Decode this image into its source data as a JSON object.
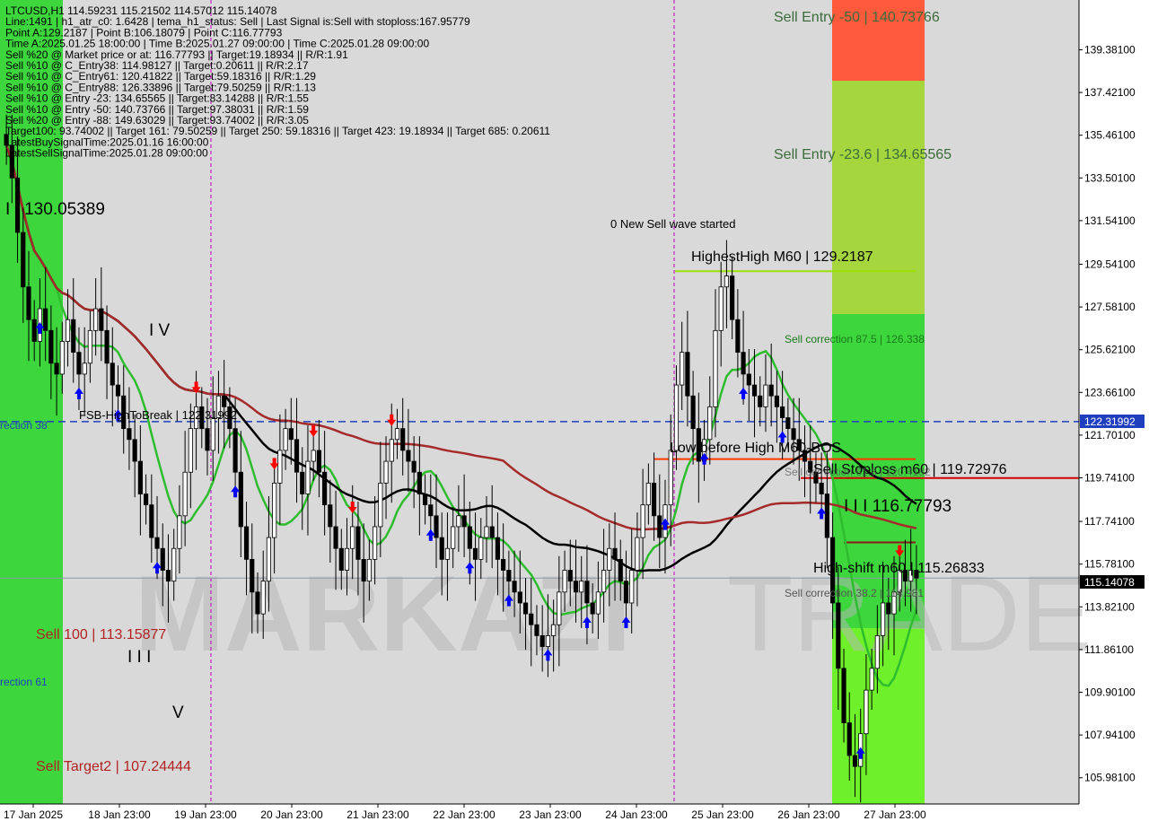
{
  "colors": {
    "background": "#dcdcdc",
    "panel_bg": "#ffffff",
    "up_candle": "#000000",
    "down_candle": "#000000",
    "wave_text": "#000000",
    "green_zone": "#3dd63d",
    "red_zone": "#ff5a3c",
    "fsb_line": "#1f3fbf",
    "price_label_bg": "#1f3fbf",
    "current_price_bg": "#000000",
    "sell_label": "#b22222",
    "ma_black": "#000000",
    "ma_brown": "#a52a2a",
    "ma_green": "#2ebd2e",
    "band_orange": "#ff6a00",
    "stoploss_red": "#d40000"
  },
  "info_panel": {
    "lines": [
      "LTCUSD,H1  114.59231 115.21502 114.57012 115.14078",
      "Line:1491 | h1_atr_c0: 1.6428 | tema_h1_status: Sell | Last Signal is:Sell with stoploss:167.95779",
      "Point A:129.2187 | Point B:106.18079 | Point C:116.77793",
      "Time A:2025.01.25 18:00:00 | Time B:2025.01.27 09:00:00 | Time C:2025.01.28 09:00:00",
      "Sell %20 @ Market price or at: 116.77793 || Target:19.18934 || R/R:1.91",
      "Sell %10 @ C_Entry38: 114.98127 || Target:0.20611 || R/R:2.17",
      "Sell %10 @ C_Entry61: 120.41822 || Target:59.18316 || R/R:1.29",
      "Sell %10 @ C_Entry88: 126.33896 || Target:79.50259 || R/R:1.13",
      "Sell %10 @ Entry -23: 134.65565 || Target:83.14288 || R/R:1.55",
      "Sell %10 @ Entry -50: 140.73766 || Target:97.38031 || R/R:1.59",
      "Sell %20 @ Entry -88: 149.63029 || Target:93.74002 || R/R:3.05",
      "Target100: 93.74002 || Target 161: 79.50259 || Target 250: 59.18316 || Target 423: 19.18934 || Target 685: 0.20611",
      "LatestBuySignalTime:2025.01.16 16:00:00",
      "LatestSellSignalTime:2025.01.28 09:00:00"
    ]
  },
  "levels": {
    "sell_entry_50": "Sell Entry -50 | 140.73766",
    "sell_entry_23": "Sell Entry -23.6 | 134.65565",
    "new_sell_wave": "0 New Sell wave started",
    "highest_high": "HighestHigh   M60 | 129.2187",
    "sell_correction_875": "Sell correction 87.5 | 126.338",
    "fsb_high": "FSB-HighToBreak | 122.31992",
    "correction_38": "rection 38",
    "low_before_high": "Low before High   M60-BOS",
    "sell_stoploss": "Sell Stoploss m60 | 119.72976",
    "sell_correction_mid": "Sell correction 61.8 | 120.4182",
    "wave_iii_price": "I I I 116.77793",
    "high_shift": "High-shift m60 | 115.26833",
    "sell_correction_low": "Sell correction 38.2 | 114.981",
    "sell_100": "Sell 100 | 113.15877",
    "correction_61": "rection 61",
    "sell_target2": "Sell Target2 | 107.24444",
    "wave_ii": "I I  130.05389",
    "wave_iv": "I V",
    "wave_iii_left": "I I I",
    "wave_v": "V"
  },
  "chart_data": {
    "type": "candlestick",
    "title": "LTCUSD,H1",
    "ylim": [
      104.9,
      141.5
    ],
    "y_ticks": [
      "139.38100",
      "137.42100",
      "135.46100",
      "133.50100",
      "131.54100",
      "129.54100",
      "127.58100",
      "125.62100",
      "123.66100",
      "121.70100",
      "119.74100",
      "117.74100",
      "115.78100",
      "113.82100",
      "111.86100",
      "109.90100",
      "107.94100",
      "105.98100"
    ],
    "x_ticks": [
      "17 Jan 2025",
      "18 Jan 23:00",
      "19 Jan 23:00",
      "20 Jan 23:00",
      "21 Jan 23:00",
      "22 Jan 23:00",
      "23 Jan 23:00",
      "24 Jan 23:00",
      "25 Jan 23:00",
      "26 Jan 23:00",
      "27 Jan 23:00"
    ],
    "price_labels": {
      "fsb": "122.31992",
      "current": "115.14078"
    },
    "key_prices": {
      "fsb": 122.31992,
      "current": 115.14078,
      "highest_high": 129.2187,
      "low_before_high": 120.6,
      "stoploss": 119.72976,
      "wave_iii": 116.77793,
      "high_shift": 115.26833
    },
    "close": [
      135.0,
      133.5,
      131.0,
      128.5,
      127.0,
      126.0,
      127.5,
      126.5,
      125.0,
      124.5,
      126.0,
      127.0,
      125.5,
      124.5,
      125.0,
      126.5,
      127.5,
      126.5,
      125.0,
      124.0,
      123.5,
      122.0,
      121.5,
      120.5,
      119.0,
      118.5,
      117.0,
      116.5,
      115.5,
      115.0,
      116.5,
      118.0,
      120.0,
      122.0,
      123.0,
      122.0,
      121.0,
      122.5,
      123.5,
      123.0,
      122.0,
      120.0,
      117.5,
      116.0,
      114.5,
      113.5,
      115.0,
      117.0,
      119.5,
      121.0,
      122.0,
      121.5,
      120.0,
      119.0,
      120.5,
      121.0,
      120.0,
      118.5,
      117.5,
      116.5,
      115.5,
      116.5,
      117.5,
      116.0,
      115.0,
      116.0,
      117.5,
      119.5,
      120.5,
      121.5,
      122.0,
      121.0,
      120.5,
      120.0,
      119.0,
      118.5,
      118.0,
      117.0,
      116.0,
      116.5,
      117.5,
      118.0,
      117.5,
      116.5,
      116.0,
      117.0,
      117.5,
      117.0,
      116.0,
      115.5,
      115.0,
      114.5,
      114.0,
      113.5,
      113.0,
      112.5,
      112.0,
      112.5,
      113.0,
      114.5,
      115.5,
      115.0,
      114.5,
      115.0,
      114.0,
      113.5,
      114.5,
      115.5,
      116.5,
      116.0,
      115.0,
      114.0,
      115.5,
      117.0,
      118.5,
      119.5,
      118.0,
      117.0,
      118.5,
      121.0,
      124.0,
      125.5,
      123.5,
      122.0,
      120.5,
      121.5,
      123.0,
      126.5,
      128.5,
      129.0,
      127.0,
      125.5,
      124.5,
      124.0,
      123.5,
      123.0,
      124.0,
      123.5,
      123.0,
      122.5,
      122.0,
      121.5,
      121.0,
      120.5,
      120.0,
      119.5,
      119.0,
      117.0,
      114.0,
      111.0,
      108.5,
      107.0,
      106.5,
      108.0,
      110.0,
      111.0,
      112.5,
      114.0,
      113.5,
      114.5,
      115.5,
      115.0,
      115.5,
      115.14
    ]
  }
}
